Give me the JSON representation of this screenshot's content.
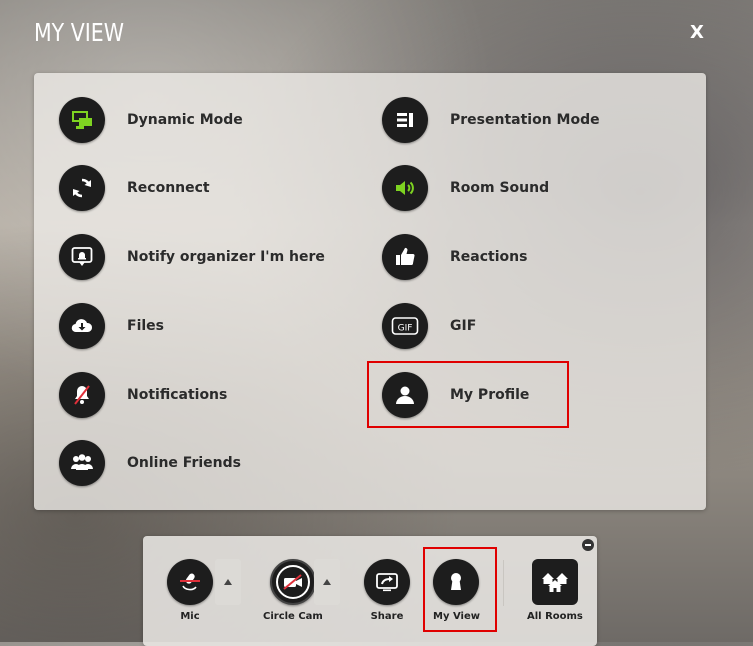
{
  "header": {
    "title": "MY VIEW",
    "close_label": "X"
  },
  "menu": {
    "dynamic_mode": "Dynamic Mode",
    "presentation_mode": "Presentation Mode",
    "reconnect": "Reconnect",
    "room_sound": "Room Sound",
    "notify_organizer": "Notify organizer I'm here",
    "reactions": "Reactions",
    "files": "Files",
    "gif": "GIF",
    "notifications": "Notifications",
    "my_profile": "My Profile",
    "online_friends": "Online Friends"
  },
  "toolbar": {
    "mic": "Mic",
    "circle_cam": "Circle Cam",
    "share": "Share",
    "my_view": "My View",
    "all_rooms": "All Rooms"
  },
  "colors": {
    "accent_green": "#7ed321",
    "highlight_red": "#e00000",
    "icon_bg": "#1d1d1d",
    "muted_red": "#e0303a"
  }
}
